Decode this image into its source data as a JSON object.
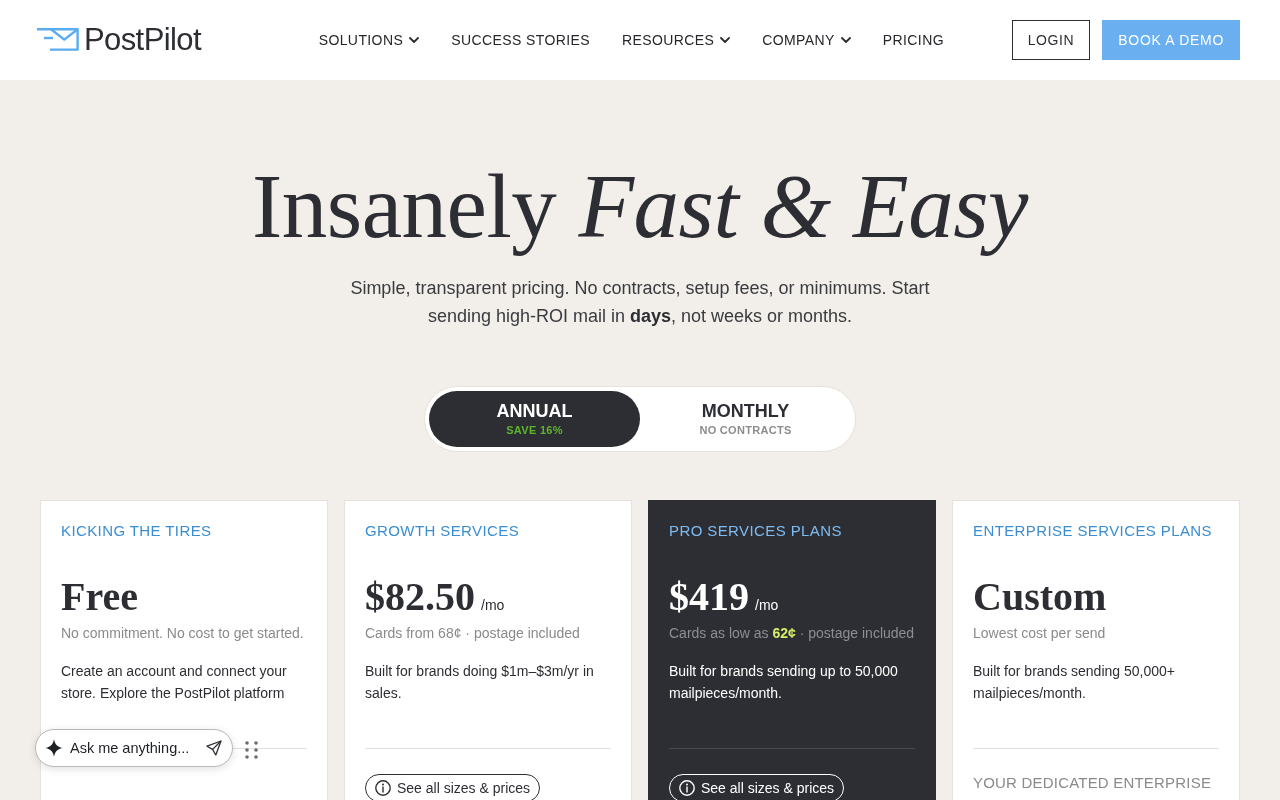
{
  "nav": {
    "logo": "PostPilot",
    "links": [
      {
        "label": "SOLUTIONS",
        "dropdown": true
      },
      {
        "label": "SUCCESS STORIES",
        "dropdown": false
      },
      {
        "label": "RESOURCES",
        "dropdown": true
      },
      {
        "label": "COMPANY",
        "dropdown": true
      },
      {
        "label": "PRICING",
        "dropdown": false
      }
    ],
    "login": "LOGIN",
    "demo": "BOOK A DEMO"
  },
  "hero": {
    "title": "Insanely *Fast & Easy*",
    "subtitle": "Simple, transparent pricing. No contracts, setup fees, or minimums. Start sending high-ROI mail in **days**, not weeks or months."
  },
  "billing_toggle": [
    {
      "label": "ANNUAL",
      "note": "SAVE 16%",
      "selected": true
    },
    {
      "label": "MONTHLY",
      "note": "NO CONTRACTS",
      "selected": false
    }
  ],
  "plans": [
    {
      "name": "KICKING THE TIRES",
      "price": "Free",
      "featured": false,
      "note": "No commitment. No cost to get started.",
      "description": "Create an account and connect your store. Explore the PostPilot platform"
    },
    {
      "name": "GROWTH SERVICES",
      "price": "$82.50",
      "period": "/mo",
      "featured": false,
      "note": "Cards from 68¢ · postage included",
      "description": "Built for brands doing $1m–$3m/yr in sales.",
      "footer": {
        "kind": "button",
        "label": "See all sizes & prices"
      }
    },
    {
      "name": "PRO SERVICES PLANS",
      "price": "$419",
      "period": "/mo",
      "featured": true,
      "note": "Cards as low as **62¢** · postage included",
      "description": "Built for brands sending up to 50,000 mailpieces/month.",
      "footer": {
        "kind": "button",
        "label": "See all sizes & prices"
      }
    },
    {
      "name": "ENTERPRISE SERVICES PLANS",
      "price": "Custom",
      "featured": false,
      "note": "Lowest cost per send",
      "description": "Built for brands sending 50,000+ mailpieces/month.",
      "footer": {
        "kind": "heading",
        "label": "YOUR DEDICATED ENTERPRISE"
      }
    }
  ],
  "chat": {
    "placeholder": "Ask me anything..."
  }
}
